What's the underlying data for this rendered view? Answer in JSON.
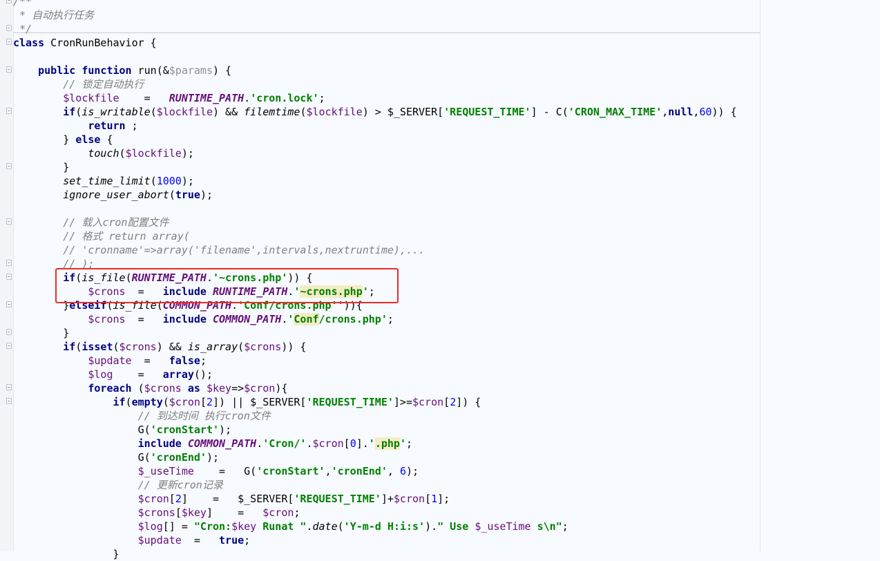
{
  "editor": {
    "language": "php",
    "highlighted_region": "if(is_file(RUNTIME_PATH.'~crons.php')) { $crons = include RUNTIME_PATH.'~crons.php';",
    "highlight_color": "#ee2a24",
    "lines": [
      [
        [
          "m",
          "/**"
        ]
      ],
      [
        [
          "m",
          " * 自动执行任务"
        ]
      ],
      [
        [
          "m",
          " */"
        ]
      ],
      [
        [
          "k",
          "class"
        ],
        [
          "p",
          " CronRunBehavior {"
        ]
      ],
      [],
      [
        [
          "p",
          "    "
        ],
        [
          "k",
          "public function"
        ],
        [
          "p",
          " run(&"
        ],
        [
          "vu",
          "$params"
        ],
        [
          "p",
          ") {"
        ]
      ],
      [
        [
          "m",
          "        // 锁定自动执行"
        ]
      ],
      [
        [
          "p",
          "        "
        ],
        [
          "v",
          "$lockfile"
        ],
        [
          "p",
          "    =   "
        ],
        [
          "c",
          "RUNTIME_PATH"
        ],
        [
          "p",
          "."
        ],
        [
          "s",
          "'cron.lock'"
        ],
        [
          "p",
          ";"
        ]
      ],
      [
        [
          "p",
          "        "
        ],
        [
          "k",
          "if"
        ],
        [
          "p",
          "("
        ],
        [
          "f",
          "is_writable"
        ],
        [
          "p",
          "("
        ],
        [
          "v",
          "$lockfile"
        ],
        [
          "p",
          ") && "
        ],
        [
          "f",
          "filemtime"
        ],
        [
          "p",
          "("
        ],
        [
          "v",
          "$lockfile"
        ],
        [
          "p",
          ") > $_SERVER["
        ],
        [
          "s",
          "'REQUEST_TIME'"
        ],
        [
          "p",
          "] - C("
        ],
        [
          "s",
          "'CRON_MAX_TIME'"
        ],
        [
          "p",
          ","
        ],
        [
          "k",
          "null"
        ],
        [
          "p",
          ","
        ],
        [
          "n",
          "60"
        ],
        [
          "p",
          ")) {"
        ]
      ],
      [
        [
          "p",
          "            "
        ],
        [
          "k",
          "return"
        ],
        [
          "p",
          " ;"
        ]
      ],
      [
        [
          "p",
          "        } "
        ],
        [
          "k",
          "else"
        ],
        [
          "p",
          " {"
        ]
      ],
      [
        [
          "p",
          "            "
        ],
        [
          "f",
          "touch"
        ],
        [
          "p",
          "("
        ],
        [
          "v",
          "$lockfile"
        ],
        [
          "p",
          ");"
        ]
      ],
      [
        [
          "p",
          "        }"
        ]
      ],
      [
        [
          "p",
          "        "
        ],
        [
          "f",
          "set_time_limit"
        ],
        [
          "p",
          "("
        ],
        [
          "n",
          "1000"
        ],
        [
          "p",
          ");"
        ]
      ],
      [
        [
          "p",
          "        "
        ],
        [
          "f",
          "ignore_user_abort"
        ],
        [
          "p",
          "("
        ],
        [
          "k",
          "true"
        ],
        [
          "p",
          ");"
        ]
      ],
      [],
      [
        [
          "m",
          "        // 载入cron配置文件"
        ]
      ],
      [
        [
          "m",
          "        // 格式 return array("
        ]
      ],
      [
        [
          "m",
          "        // 'cronname'=>array('filename',intervals,nextruntime),..."
        ]
      ],
      [
        [
          "m",
          "        // );"
        ]
      ],
      [
        [
          "p",
          "        "
        ],
        [
          "k",
          "if"
        ],
        [
          "p",
          "("
        ],
        [
          "f",
          "is_file"
        ],
        [
          "p",
          "("
        ],
        [
          "c",
          "RUNTIME_PATH"
        ],
        [
          "p",
          "."
        ],
        [
          "s",
          "'~crons.php'"
        ],
        [
          "p",
          ")) {"
        ]
      ],
      [
        [
          "p",
          "            "
        ],
        [
          "v",
          "$crons"
        ],
        [
          "p",
          "  =   "
        ],
        [
          "k",
          "include"
        ],
        [
          "p",
          " "
        ],
        [
          "c",
          "RUNTIME_PATH"
        ],
        [
          "p",
          "."
        ],
        [
          "s",
          "'"
        ],
        [
          "h",
          "~crons.php"
        ],
        [
          "s",
          "'"
        ],
        [
          "p",
          ";"
        ]
      ],
      [
        [
          "p",
          "        }"
        ],
        [
          "k",
          "elseif"
        ],
        [
          "p",
          "("
        ],
        [
          "f",
          "is_file"
        ],
        [
          "p",
          "("
        ],
        [
          "c",
          "COMMON_PATH"
        ],
        [
          "p",
          "."
        ],
        [
          "s",
          "'Conf/crons.php'"
        ],
        [
          "p",
          "')){"
        ]
      ],
      [
        [
          "p",
          "            "
        ],
        [
          "v",
          "$crons"
        ],
        [
          "p",
          "  =   "
        ],
        [
          "k",
          "include"
        ],
        [
          "p",
          " "
        ],
        [
          "c",
          "COMMON_PATH"
        ],
        [
          "p",
          "."
        ],
        [
          "s",
          "'"
        ],
        [
          "h",
          "Conf"
        ],
        [
          "s",
          "/crons.php'"
        ],
        [
          "p",
          ";"
        ]
      ],
      [
        [
          "p",
          "        }"
        ]
      ],
      [
        [
          "p",
          "        "
        ],
        [
          "k",
          "if"
        ],
        [
          "p",
          "("
        ],
        [
          "k",
          "isset"
        ],
        [
          "p",
          "("
        ],
        [
          "v",
          "$crons"
        ],
        [
          "p",
          ") && "
        ],
        [
          "f",
          "is_array"
        ],
        [
          "p",
          "("
        ],
        [
          "v",
          "$crons"
        ],
        [
          "p",
          ")) {"
        ]
      ],
      [
        [
          "p",
          "            "
        ],
        [
          "v",
          "$update"
        ],
        [
          "p",
          "  =   "
        ],
        [
          "k",
          "false"
        ],
        [
          "p",
          ";"
        ]
      ],
      [
        [
          "p",
          "            "
        ],
        [
          "v",
          "$log"
        ],
        [
          "p",
          "    =   "
        ],
        [
          "k",
          "array"
        ],
        [
          "p",
          "();"
        ]
      ],
      [
        [
          "p",
          "            "
        ],
        [
          "k",
          "foreach"
        ],
        [
          "p",
          " ("
        ],
        [
          "v",
          "$crons"
        ],
        [
          "p",
          " "
        ],
        [
          "k",
          "as"
        ],
        [
          "p",
          " "
        ],
        [
          "v",
          "$key"
        ],
        [
          "p",
          "=>"
        ],
        [
          "v",
          "$cron"
        ],
        [
          "p",
          "){"
        ]
      ],
      [
        [
          "p",
          "                "
        ],
        [
          "k",
          "if"
        ],
        [
          "p",
          "("
        ],
        [
          "k",
          "empty"
        ],
        [
          "p",
          "("
        ],
        [
          "v",
          "$cron"
        ],
        [
          "p",
          "["
        ],
        [
          "n",
          "2"
        ],
        [
          "p",
          "]) || $_SERVER["
        ],
        [
          "s",
          "'REQUEST_TIME'"
        ],
        [
          "p",
          "]>="
        ],
        [
          "v",
          "$cron"
        ],
        [
          "p",
          "["
        ],
        [
          "n",
          "2"
        ],
        [
          "p",
          "]) {"
        ]
      ],
      [
        [
          "m",
          "                    // 到达时间 执行cron文件"
        ]
      ],
      [
        [
          "p",
          "                    G("
        ],
        [
          "s",
          "'cronStart'"
        ],
        [
          "p",
          ");"
        ]
      ],
      [
        [
          "p",
          "                    "
        ],
        [
          "k",
          "include"
        ],
        [
          "p",
          " "
        ],
        [
          "c",
          "COMMON_PATH"
        ],
        [
          "p",
          "."
        ],
        [
          "s",
          "'Cron/'"
        ],
        [
          "p",
          "."
        ],
        [
          "v",
          "$cron"
        ],
        [
          "p",
          "["
        ],
        [
          "n",
          "0"
        ],
        [
          "p",
          "]."
        ],
        [
          "s",
          "'"
        ],
        [
          "h",
          ".php"
        ],
        [
          "s",
          "'"
        ],
        [
          "p",
          ";"
        ]
      ],
      [
        [
          "p",
          "                    G("
        ],
        [
          "s",
          "'cronEnd'"
        ],
        [
          "p",
          ");"
        ]
      ],
      [
        [
          "p",
          "                    "
        ],
        [
          "v",
          "$_useTime"
        ],
        [
          "p",
          "    =   G("
        ],
        [
          "s",
          "'cronStart'"
        ],
        [
          "p",
          ","
        ],
        [
          "s",
          "'cronEnd'"
        ],
        [
          "p",
          ", "
        ],
        [
          "n",
          "6"
        ],
        [
          "p",
          ");"
        ]
      ],
      [
        [
          "m",
          "                    // 更新cron记录"
        ]
      ],
      [
        [
          "p",
          "                    "
        ],
        [
          "v",
          "$cron"
        ],
        [
          "p",
          "["
        ],
        [
          "n",
          "2"
        ],
        [
          "p",
          "]    =   $_SERVER["
        ],
        [
          "s",
          "'REQUEST_TIME'"
        ],
        [
          "p",
          "]+"
        ],
        [
          "v",
          "$cron"
        ],
        [
          "p",
          "["
        ],
        [
          "n",
          "1"
        ],
        [
          "p",
          "];"
        ]
      ],
      [
        [
          "p",
          "                    "
        ],
        [
          "v",
          "$crons"
        ],
        [
          "p",
          "["
        ],
        [
          "v",
          "$key"
        ],
        [
          "p",
          "]    =   "
        ],
        [
          "v",
          "$cron"
        ],
        [
          "p",
          ";"
        ]
      ],
      [
        [
          "p",
          "                    "
        ],
        [
          "v",
          "$log"
        ],
        [
          "p",
          "[] = "
        ],
        [
          "s",
          "\"Cron:"
        ],
        [
          "v",
          "$key"
        ],
        [
          "s",
          " Runat \""
        ],
        [
          "p",
          "."
        ],
        [
          "f",
          "date"
        ],
        [
          "p",
          "("
        ],
        [
          "s",
          "'Y-m-d H:i:s'"
        ],
        [
          "p",
          ")."
        ],
        [
          "s",
          "\" Use "
        ],
        [
          "v",
          "$_useTime"
        ],
        [
          "s",
          " s\\n\""
        ],
        [
          "p",
          ";"
        ]
      ],
      [
        [
          "p",
          "                    "
        ],
        [
          "v",
          "$update"
        ],
        [
          "p",
          "  =   "
        ],
        [
          "k",
          "true"
        ],
        [
          "p",
          ";"
        ]
      ],
      [
        [
          "p",
          "                }"
        ]
      ]
    ]
  }
}
